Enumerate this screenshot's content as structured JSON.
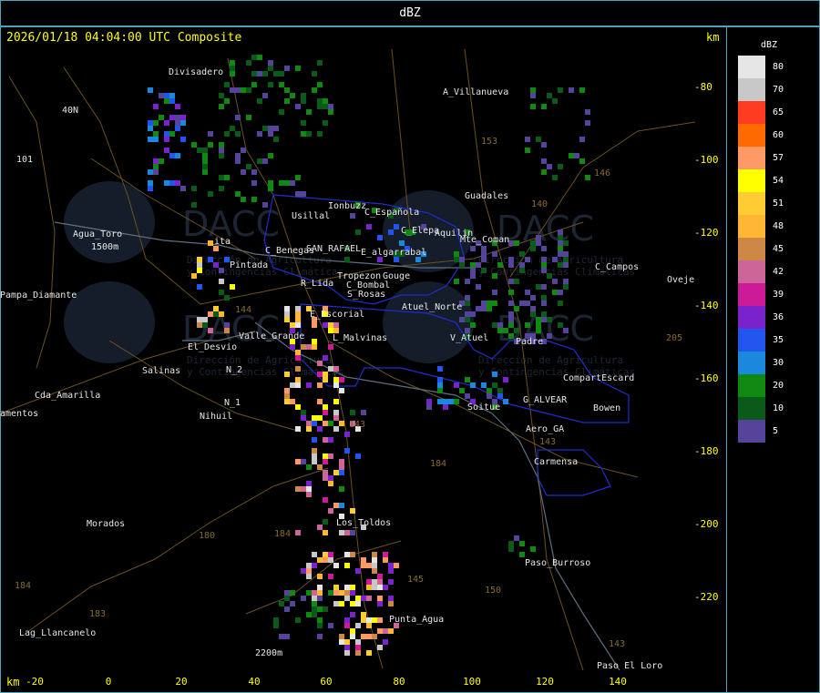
{
  "window": {
    "title": "dBZ"
  },
  "header": {
    "timestamp": "2026/01/18 04:04:00 UTC Composite",
    "unit_top": "km",
    "unit_bottom": "km"
  },
  "axes": {
    "y_ticks": [
      "-80",
      "-100",
      "-120",
      "-140",
      "-160",
      "-180",
      "-200",
      "-220"
    ],
    "x_ticks": [
      "-20",
      "0",
      "20",
      "40",
      "60",
      "80",
      "100",
      "120",
      "140"
    ]
  },
  "legend": {
    "title": "dBZ",
    "entries": [
      {
        "label": "80",
        "color": "#e6e6e6"
      },
      {
        "label": "70",
        "color": "#c8c8c8"
      },
      {
        "label": "65",
        "color": "#ff3b22"
      },
      {
        "label": "60",
        "color": "#ff6a00"
      },
      {
        "label": "57",
        "color": "#ff9966"
      },
      {
        "label": "54",
        "color": "#ffff00"
      },
      {
        "label": "51",
        "color": "#ffcc33"
      },
      {
        "label": "48",
        "color": "#ffb733"
      },
      {
        "label": "45",
        "color": "#cc8844"
      },
      {
        "label": "42",
        "color": "#cc6699"
      },
      {
        "label": "39",
        "color": "#cc1a99"
      },
      {
        "label": "36",
        "color": "#7a22cc"
      },
      {
        "label": "35",
        "color": "#2255ee"
      },
      {
        "label": "30",
        "color": "#1a88dd"
      },
      {
        "label": "20",
        "color": "#118811"
      },
      {
        "label": "10",
        "color": "#0a5a1a"
      },
      {
        "label": "5",
        "color": "#554499"
      }
    ]
  },
  "map_labels": {
    "cities": [
      "Divisadero",
      "A_Villanueva",
      "40N",
      "101",
      "Usillal",
      "Ionbuzz",
      "C_Española",
      "C_Elepa",
      "Aquilin",
      "Mte_Coman",
      "Guadales",
      "Agua_Toro",
      "1500m",
      "C_Benegas",
      "SAN_RAFAEL",
      "E_algarrabal",
      "C_Campos",
      "Pampa_Diamante",
      "ita",
      "Pintada",
      "Tropezon",
      "Gouge",
      "C_Bombal",
      "R_Lida",
      "S_Rosas",
      "Atuel_Norte",
      "Oveje",
      "E_Escorial",
      "Valle_Grande",
      "L_Malvinas",
      "V_Atuel",
      "Padre",
      "El_Desvio",
      "N_2",
      "Salinas",
      "Cda_Amarilla",
      "amentos",
      "N_1",
      "Nihuil",
      "CompartEscard",
      "Bowen",
      "G_ALVEAR",
      "Soitue",
      "Aero_GA",
      "Carmensa",
      "Morados",
      "Los_Toldos",
      "Paso_Burroso",
      "Punta_Agua",
      "Lag_Llancanelo",
      "2200m",
      "Paso_El_Loro"
    ],
    "roads": [
      "153",
      "146",
      "140",
      "143",
      "144",
      "143",
      "180",
      "184",
      "183",
      "184",
      "150",
      "143",
      "205",
      "145",
      "184"
    ]
  },
  "watermark": {
    "brand": "DACC",
    "caption_1": "Dirección de Agricultura",
    "caption_2": "y Contingencias Climáticas"
  },
  "colors": {
    "axis": "#ffff00",
    "border": "#4fa3b8",
    "roads": "#6b5120",
    "districts": "#1e2dcc",
    "rivers": "#6b7b8b"
  }
}
